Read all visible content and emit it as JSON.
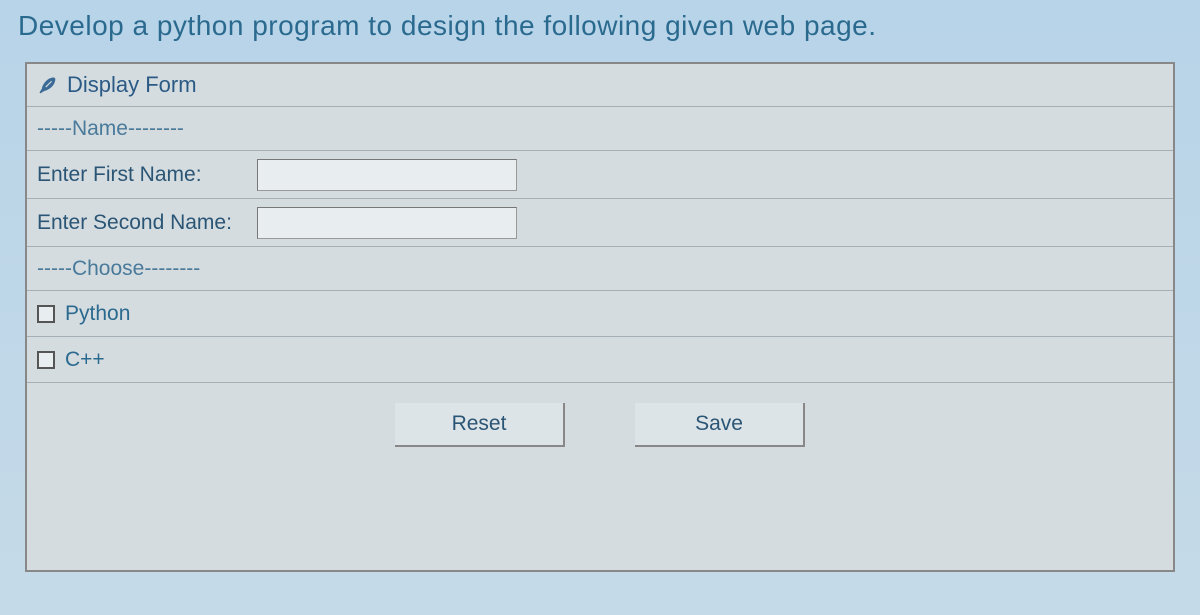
{
  "question": "Develop a python program to design the following given web page.",
  "form": {
    "windowTitle": "Display Form",
    "sectionName": "-----Name--------",
    "firstNameLabel": "Enter First Name:",
    "firstNameValue": "",
    "secondNameLabel": "Enter Second Name:",
    "secondNameValue": "",
    "sectionChoose": "-----Choose--------",
    "checkboxes": [
      {
        "label": "Python"
      },
      {
        "label": "C++"
      }
    ],
    "buttons": {
      "reset": "Reset",
      "save": "Save"
    }
  }
}
